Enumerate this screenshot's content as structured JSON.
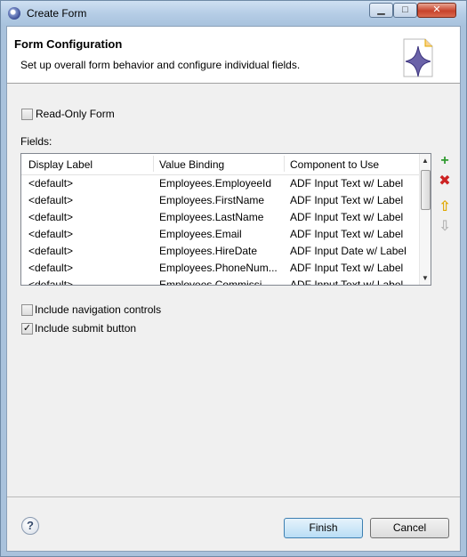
{
  "window": {
    "title": "Create Form"
  },
  "banner": {
    "title": "Form Configuration",
    "description": "Set up overall form behavior and configure individual fields."
  },
  "options": {
    "read_only_form": {
      "label": "Read-Only Form",
      "checked": false
    },
    "include_navigation": {
      "label": "Include navigation controls",
      "checked": false
    },
    "include_submit": {
      "label": "Include submit button",
      "checked": true
    }
  },
  "fields": {
    "label": "Fields:",
    "columns": [
      "Display Label",
      "Value Binding",
      "Component to Use"
    ],
    "rows": [
      [
        "<default>",
        "Employees.EmployeeId",
        "ADF Input Text w/ Label"
      ],
      [
        "<default>",
        "Employees.FirstName",
        "ADF Input Text w/ Label"
      ],
      [
        "<default>",
        "Employees.LastName",
        "ADF Input Text w/ Label"
      ],
      [
        "<default>",
        "Employees.Email",
        "ADF Input Text w/ Label"
      ],
      [
        "<default>",
        "Employees.HireDate",
        "ADF Input Date w/ Label"
      ],
      [
        "<default>",
        "Employees.PhoneNum...",
        "ADF Input Text w/ Label"
      ],
      [
        "<default>",
        "Employees.Commissi...",
        "ADF Input Text w/ Label"
      ]
    ],
    "actions": [
      "add-icon",
      "remove-icon",
      "move-up-icon",
      "move-down-icon"
    ]
  },
  "buttons": {
    "finish": "Finish",
    "cancel": "Cancel"
  },
  "colors": {
    "add": "#2f9a2f",
    "remove": "#cc2222",
    "move": "#e0a800",
    "disabled": "#b4b4b4"
  }
}
